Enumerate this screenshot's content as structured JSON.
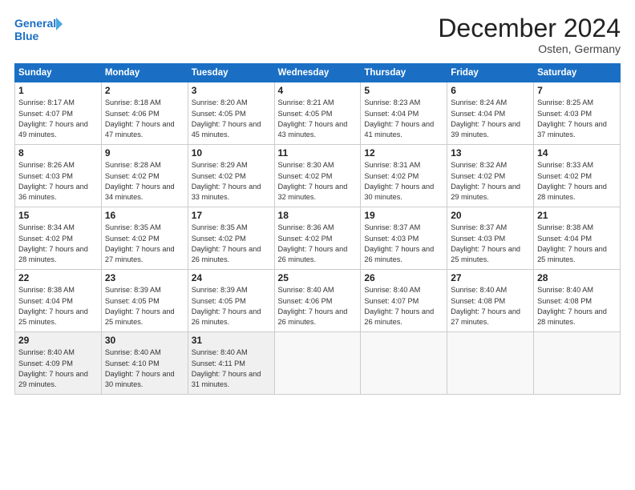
{
  "header": {
    "logo_line1": "General",
    "logo_line2": "Blue",
    "month": "December 2024",
    "location": "Osten, Germany"
  },
  "weekdays": [
    "Sunday",
    "Monday",
    "Tuesday",
    "Wednesday",
    "Thursday",
    "Friday",
    "Saturday"
  ],
  "weeks": [
    [
      {
        "day": "1",
        "rise": "8:17 AM",
        "set": "4:07 PM",
        "daylight": "7 hours and 49 minutes."
      },
      {
        "day": "2",
        "rise": "8:18 AM",
        "set": "4:06 PM",
        "daylight": "7 hours and 47 minutes."
      },
      {
        "day": "3",
        "rise": "8:20 AM",
        "set": "4:05 PM",
        "daylight": "7 hours and 45 minutes."
      },
      {
        "day": "4",
        "rise": "8:21 AM",
        "set": "4:05 PM",
        "daylight": "7 hours and 43 minutes."
      },
      {
        "day": "5",
        "rise": "8:23 AM",
        "set": "4:04 PM",
        "daylight": "7 hours and 41 minutes."
      },
      {
        "day": "6",
        "rise": "8:24 AM",
        "set": "4:04 PM",
        "daylight": "7 hours and 39 minutes."
      },
      {
        "day": "7",
        "rise": "8:25 AM",
        "set": "4:03 PM",
        "daylight": "7 hours and 37 minutes."
      }
    ],
    [
      {
        "day": "8",
        "rise": "8:26 AM",
        "set": "4:03 PM",
        "daylight": "7 hours and 36 minutes."
      },
      {
        "day": "9",
        "rise": "8:28 AM",
        "set": "4:02 PM",
        "daylight": "7 hours and 34 minutes."
      },
      {
        "day": "10",
        "rise": "8:29 AM",
        "set": "4:02 PM",
        "daylight": "7 hours and 33 minutes."
      },
      {
        "day": "11",
        "rise": "8:30 AM",
        "set": "4:02 PM",
        "daylight": "7 hours and 32 minutes."
      },
      {
        "day": "12",
        "rise": "8:31 AM",
        "set": "4:02 PM",
        "daylight": "7 hours and 30 minutes."
      },
      {
        "day": "13",
        "rise": "8:32 AM",
        "set": "4:02 PM",
        "daylight": "7 hours and 29 minutes."
      },
      {
        "day": "14",
        "rise": "8:33 AM",
        "set": "4:02 PM",
        "daylight": "7 hours and 28 minutes."
      }
    ],
    [
      {
        "day": "15",
        "rise": "8:34 AM",
        "set": "4:02 PM",
        "daylight": "7 hours and 28 minutes."
      },
      {
        "day": "16",
        "rise": "8:35 AM",
        "set": "4:02 PM",
        "daylight": "7 hours and 27 minutes."
      },
      {
        "day": "17",
        "rise": "8:35 AM",
        "set": "4:02 PM",
        "daylight": "7 hours and 26 minutes."
      },
      {
        "day": "18",
        "rise": "8:36 AM",
        "set": "4:02 PM",
        "daylight": "7 hours and 26 minutes."
      },
      {
        "day": "19",
        "rise": "8:37 AM",
        "set": "4:03 PM",
        "daylight": "7 hours and 26 minutes."
      },
      {
        "day": "20",
        "rise": "8:37 AM",
        "set": "4:03 PM",
        "daylight": "7 hours and 25 minutes."
      },
      {
        "day": "21",
        "rise": "8:38 AM",
        "set": "4:04 PM",
        "daylight": "7 hours and 25 minutes."
      }
    ],
    [
      {
        "day": "22",
        "rise": "8:38 AM",
        "set": "4:04 PM",
        "daylight": "7 hours and 25 minutes."
      },
      {
        "day": "23",
        "rise": "8:39 AM",
        "set": "4:05 PM",
        "daylight": "7 hours and 25 minutes."
      },
      {
        "day": "24",
        "rise": "8:39 AM",
        "set": "4:05 PM",
        "daylight": "7 hours and 26 minutes."
      },
      {
        "day": "25",
        "rise": "8:40 AM",
        "set": "4:06 PM",
        "daylight": "7 hours and 26 minutes."
      },
      {
        "day": "26",
        "rise": "8:40 AM",
        "set": "4:07 PM",
        "daylight": "7 hours and 26 minutes."
      },
      {
        "day": "27",
        "rise": "8:40 AM",
        "set": "4:08 PM",
        "daylight": "7 hours and 27 minutes."
      },
      {
        "day": "28",
        "rise": "8:40 AM",
        "set": "4:08 PM",
        "daylight": "7 hours and 28 minutes."
      }
    ],
    [
      {
        "day": "29",
        "rise": "8:40 AM",
        "set": "4:09 PM",
        "daylight": "7 hours and 29 minutes."
      },
      {
        "day": "30",
        "rise": "8:40 AM",
        "set": "4:10 PM",
        "daylight": "7 hours and 30 minutes."
      },
      {
        "day": "31",
        "rise": "8:40 AM",
        "set": "4:11 PM",
        "daylight": "7 hours and 31 minutes."
      },
      null,
      null,
      null,
      null
    ]
  ]
}
